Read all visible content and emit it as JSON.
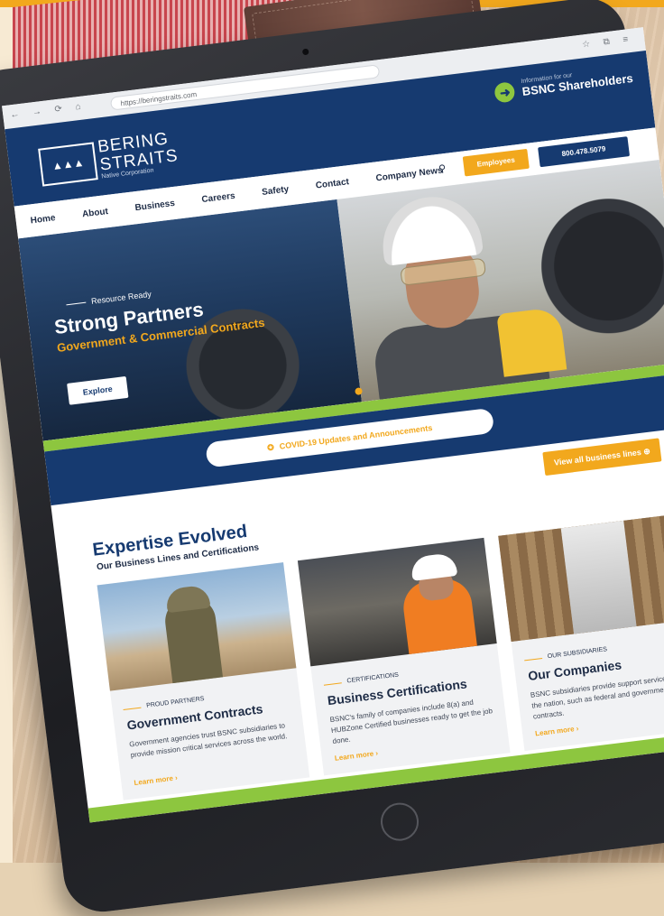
{
  "browser": {
    "url": "https://beringstraits.com",
    "nav_icons": "← → ⟳ ⌂",
    "right_icons": "☆ ⧉ ≡"
  },
  "header": {
    "logo_mark": "▲▲▲",
    "logo_line1": "BERING",
    "logo_line2": "STRAITS",
    "logo_line3": "Native Corporation",
    "shareholder_small": "Information for our",
    "shareholder_big": "BSNC Shareholders",
    "arrow": "➜"
  },
  "nav": {
    "items": [
      "Home",
      "About",
      "Business",
      "Careers",
      "Safety",
      "Contact",
      "Company News"
    ],
    "search_icon": "⚲",
    "employees": "Employees",
    "phone": "800.478.5079"
  },
  "hero": {
    "kicker": "Resource Ready",
    "title": "Strong Partners",
    "subtitle": "Government & Commercial Contracts",
    "button": "Explore"
  },
  "covid": {
    "icon": "✪",
    "text": "COVID-19 Updates and Announcements"
  },
  "expertise": {
    "view_all": "View all business lines ⊕",
    "title": "Expertise Evolved",
    "subtitle": "Our Business Lines and Certifications"
  },
  "cards": [
    {
      "label": "PROUD PARTNERS",
      "title": "Government Contracts",
      "text": "Government agencies trust BSNC subsidiaries to provide mission critical services across the world.",
      "link": "Learn more ›"
    },
    {
      "label": "CERTIFICATIONS",
      "title": "Business Certifications",
      "text": "BSNC's family of companies include 8(a) and HUBZone Certified businesses ready to get the job done.",
      "link": "Learn more ›"
    },
    {
      "label": "OUR SUBSIDIARIES",
      "title": "Our Companies",
      "text": "BSNC subsidiaries provide support services across the nation, such as federal and government contracts.",
      "link": "Learn more ›"
    }
  ],
  "colors": {
    "navy": "#163a70",
    "gold": "#f2a81d",
    "green": "#8dc63f"
  }
}
